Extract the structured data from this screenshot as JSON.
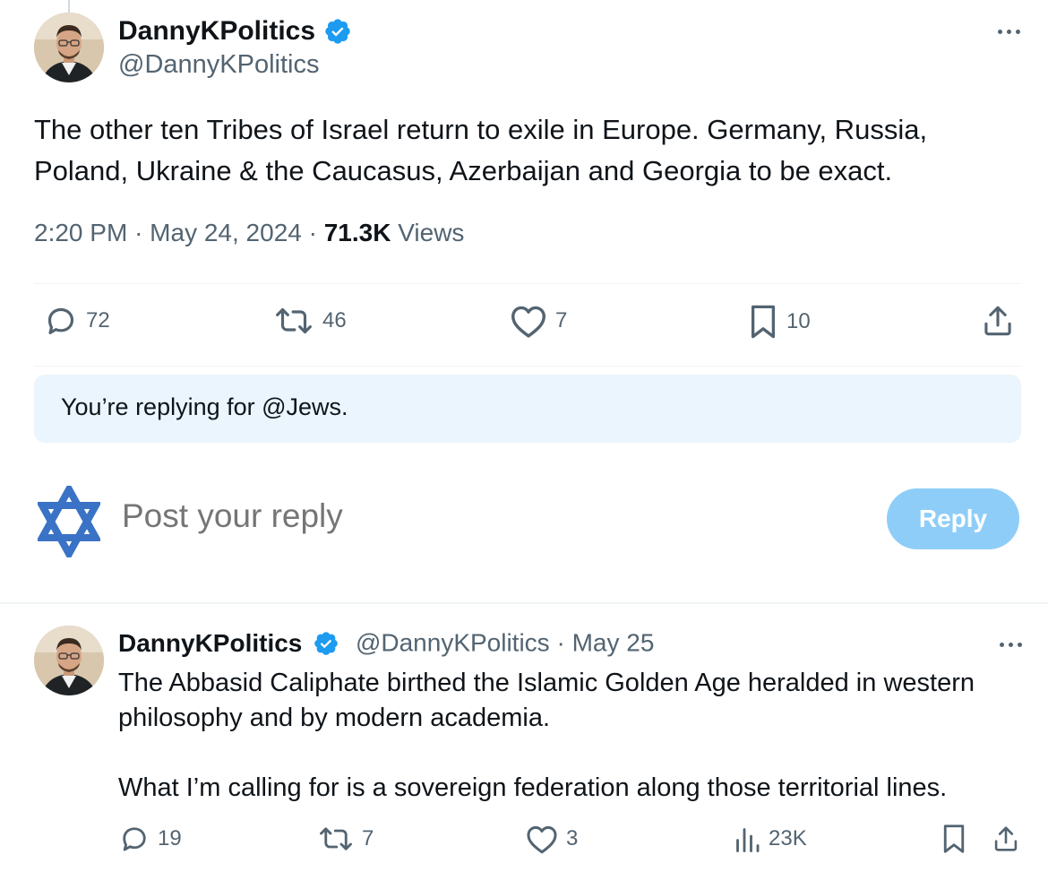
{
  "main_tweet": {
    "display_name": "DannyKPolitics",
    "handle": "@DannyKPolitics",
    "text": "The other ten Tribes of Israel return to exile in Europe. Germany, Russia, Poland, Ukraine & the Caucasus, Azerbaijan and Georgia to be exact.",
    "time": "2:20 PM",
    "date": "May 24, 2024",
    "views_count": "71.3K",
    "views_label": "Views",
    "stats": {
      "replies": "72",
      "reposts": "46",
      "likes": "7",
      "bookmarks": "10"
    }
  },
  "replying_notice": "You’re replying for @Jews.",
  "composer": {
    "placeholder": "Post your reply",
    "button_label": "Reply"
  },
  "reply_tweet": {
    "display_name": "DannyKPolitics",
    "handle": "@DannyKPolitics",
    "separator": "·",
    "date": "May 25",
    "paragraphs": [
      "The Abbasid Caliphate birthed the Islamic Golden Age heralded in western philosophy and by modern academia.",
      "What I’m calling for is a sovereign federation along those territorial lines."
    ],
    "stats": {
      "replies": "19",
      "reposts": "7",
      "likes": "3",
      "views": "23K"
    }
  },
  "colors": {
    "verified_blue": "#1d9bf0",
    "reply_button": "#8ecdf8",
    "replying_box": "#eaf5fd",
    "star_of_david": "#3a73c6",
    "secondary_text": "#536471"
  },
  "icons": {
    "verified": "verified-badge-icon",
    "more": "more-options-icon",
    "reply": "reply-icon",
    "repost": "repost-icon",
    "like": "heart-icon",
    "bookmark": "bookmark-icon",
    "share": "share-icon",
    "views": "views-icon",
    "composer_avatar": "star-of-david-icon"
  }
}
